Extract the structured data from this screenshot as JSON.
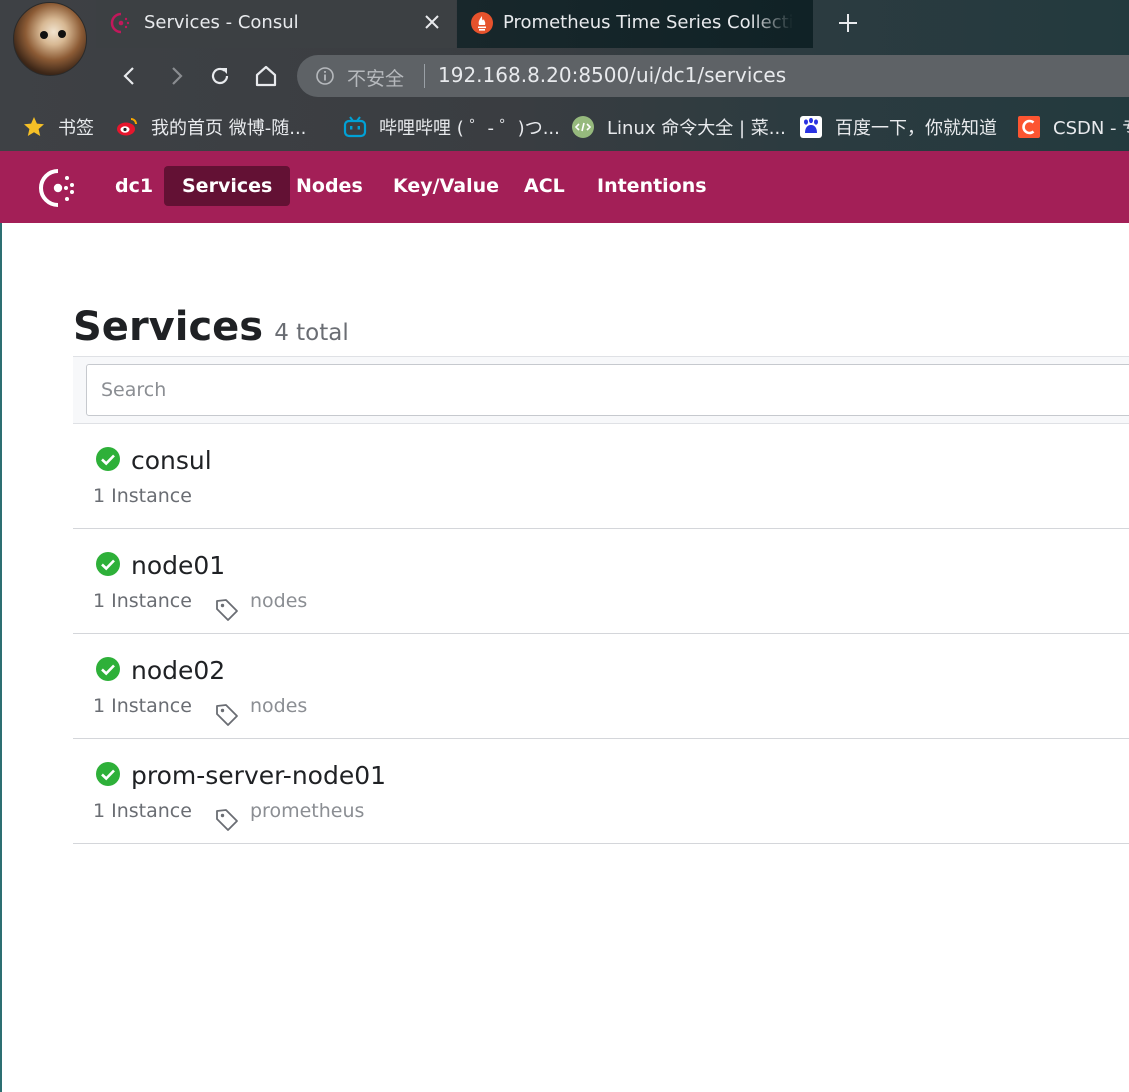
{
  "browser": {
    "tabs": [
      {
        "title": "Services - Consul",
        "active": true,
        "favicon": "consul-icon"
      },
      {
        "title": "Prometheus Time Series Collection",
        "active": false,
        "favicon": "prometheus-icon"
      }
    ],
    "address_bar": {
      "security_label": "不安全",
      "url": "192.168.8.20:8500/ui/dc1/services"
    },
    "bookmarks": [
      {
        "label": "书签",
        "icon": "star-icon"
      },
      {
        "label": "我的首页 微博-随...",
        "icon": "weibo-icon"
      },
      {
        "label": "哔哩哔哩 ( ゜- ゜)つ...",
        "icon": "bilibili-icon"
      },
      {
        "label": "Linux 命令大全 | 菜...",
        "icon": "runoob-icon"
      },
      {
        "label": "百度一下，你就知道",
        "icon": "baidu-icon"
      },
      {
        "label": "CSDN - 专",
        "icon": "csdn-icon"
      }
    ]
  },
  "consul": {
    "datacenter": "dc1",
    "nav": [
      {
        "label": "Services",
        "active": true
      },
      {
        "label": "Nodes",
        "active": false
      },
      {
        "label": "Key/Value",
        "active": false
      },
      {
        "label": "ACL",
        "active": false
      },
      {
        "label": "Intentions",
        "active": false
      }
    ],
    "accent_color": "#a31f57",
    "active_nav_color": "#631134"
  },
  "page": {
    "title": "Services",
    "count_label": "4 total",
    "search": {
      "placeholder": "Search",
      "value": ""
    },
    "services": [
      {
        "name": "consul",
        "instances": "1 Instance",
        "tags": [],
        "status": "passing"
      },
      {
        "name": "node01",
        "instances": "1 Instance",
        "tags": [
          "nodes"
        ],
        "status": "passing"
      },
      {
        "name": "node02",
        "instances": "1 Instance",
        "tags": [
          "nodes"
        ],
        "status": "passing"
      },
      {
        "name": "prom-server-node01",
        "instances": "1 Instance",
        "tags": [
          "prometheus"
        ],
        "status": "passing"
      }
    ],
    "status_color": "#2eb039"
  }
}
